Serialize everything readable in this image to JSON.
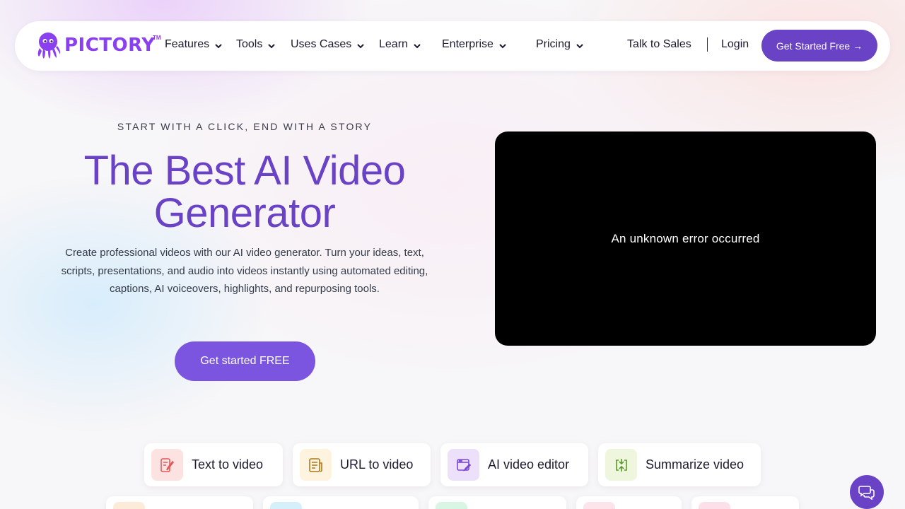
{
  "brand": {
    "name": "PICTORY",
    "tm": "TM",
    "accent": "#6a42c6",
    "logo_color": "#8a3ff0"
  },
  "nav": {
    "items": [
      {
        "label": "Features",
        "icon": "chevron-down-icon"
      },
      {
        "label": "Tools",
        "icon": "chevron-down-icon"
      },
      {
        "label": "Uses Cases",
        "icon": "chevron-down-icon"
      },
      {
        "label": "Learn",
        "icon": "chevron-down-icon"
      },
      {
        "label": "Enterprise",
        "icon": "chevron-down-icon"
      },
      {
        "label": "Pricing",
        "icon": "chevron-down-icon"
      }
    ],
    "talk_to_sales": "Talk to Sales",
    "login": "Login",
    "cta": "Get Started Free →"
  },
  "hero": {
    "eyebrow": "START WITH A CLICK, END WITH A STORY",
    "title_line1": "The Best AI Video",
    "title_line2": "Generator",
    "description": "Create professional videos with our AI video generator. Turn your ideas, text, scripts, presentations, and audio into videos instantly using automated editing, captions, AI voiceovers, highlights, and repurposing tools.",
    "cta": "Get started FREE"
  },
  "video": {
    "error_message": "An unknown error occurred"
  },
  "features": [
    {
      "label": "Text to video",
      "icon": "pen-document-icon",
      "icon_bg": "#fde2e2",
      "icon_color": "#e25b5b"
    },
    {
      "label": "URL to video",
      "icon": "article-icon",
      "icon_bg": "#fdf3de",
      "icon_color": "#b0781c"
    },
    {
      "label": "AI video editor",
      "icon": "edit-window-icon",
      "icon_bg": "#ece0fb",
      "icon_color": "#7a48d4"
    },
    {
      "label": "Summarize video",
      "icon": "compress-icon",
      "icon_bg": "#eef7de",
      "icon_color": "#5a9a2a"
    }
  ],
  "features_row2_icons": [
    {
      "icon": "feature-icon",
      "icon_bg": "#fdebd9"
    },
    {
      "icon": "feature-icon",
      "icon_bg": "#d6f0fb"
    },
    {
      "icon": "feature-icon",
      "icon_bg": "#d9f5e4"
    },
    {
      "icon": "feature-icon",
      "icon_bg": "#fce4ea"
    },
    {
      "icon": "feature-icon",
      "icon_bg": "#fbe0ea"
    }
  ],
  "chat": {
    "icon": "chat-bubbles-icon"
  }
}
